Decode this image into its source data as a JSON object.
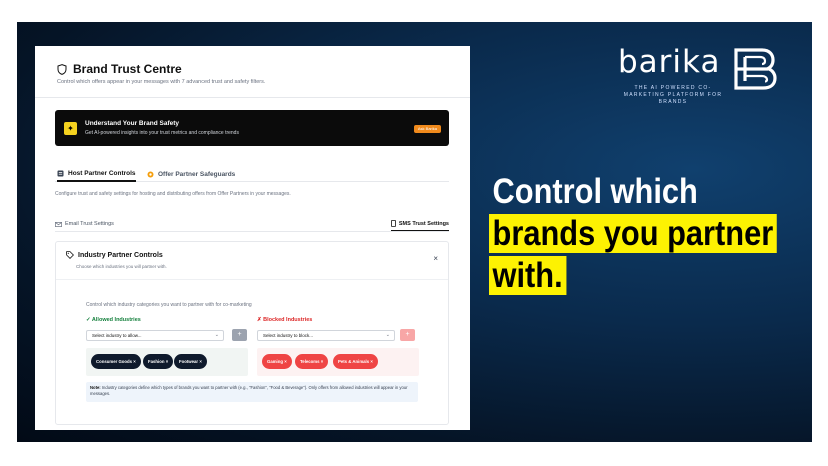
{
  "brand": {
    "name": "barika",
    "tagline": "THE AI POWERED CO-MARKETING PLATFORM FOR BRANDS",
    "mark_icon": "barika-b-logo"
  },
  "headline": {
    "line1": "Control which",
    "line2": "brands you partner",
    "line3": "with.",
    "highlight_color": "#fdf202"
  },
  "panel": {
    "title": "Brand Trust Centre",
    "title_icon": "shield-icon",
    "subtitle": "Control which offers appear in your messages with 7 advanced trust and safety filters.",
    "banner": {
      "icon": "sparkle-icon",
      "title": "Understand Your Brand Safety",
      "subtitle": "Get AI-powered insights into your trust metrics and compliance trends",
      "button": "Ask Barika"
    },
    "tabs": [
      {
        "label": "Host Partner Controls",
        "icon": "host-icon",
        "active": true
      },
      {
        "label": "Offer Partner Safeguards",
        "icon": "offer-icon",
        "active": false
      }
    ],
    "tab_description": "Configure trust and safety settings for hosting and distributing offers from Offer Partners in your messages.",
    "subtabs": [
      {
        "label": "Email Trust Settings",
        "icon": "email-icon",
        "active": false
      },
      {
        "label": "SMS Trust Settings",
        "icon": "sms-icon",
        "active": true
      }
    ],
    "card": {
      "title": "Industry Partner Controls",
      "title_icon": "tag-icon",
      "subtitle": "Choose which industries you will partner with.",
      "close": "×",
      "description": "Control which industry categories you want to partner with for co-marketing",
      "allowed": {
        "label": "✓ Allowed Industries",
        "placeholder": "Select industry to allow...",
        "add": "+",
        "chips": [
          "Consumer Goods",
          "Fashion",
          "Footwear"
        ]
      },
      "blocked": {
        "label": "✗ Blocked Industries",
        "placeholder": "Select industry to block...",
        "add": "+",
        "chips": [
          "Gaming",
          "Telecoms",
          "Pets & Animals"
        ]
      },
      "note_label": "Note:",
      "note_text": "Industry categories define which types of brands you want to partner with (e.g., \"Fashion\", \"Food & Beverage\"). Only offers from allowed industries will appear in your messages."
    }
  }
}
